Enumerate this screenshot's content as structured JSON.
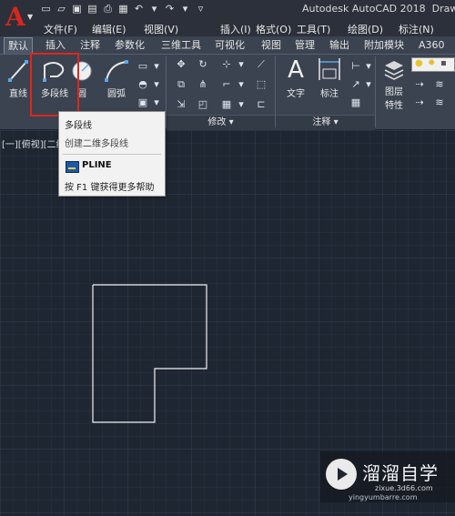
{
  "window": {
    "title": "Autodesk AutoCAD 2018",
    "title_suffix": "Draw",
    "colors": {
      "background": "#1e2632",
      "highlight": "#e0251b",
      "brand": "#d7261e"
    }
  },
  "app_button": {
    "label": "A",
    "icon": "app-menu-caret-icon"
  },
  "menu": [
    "文件(F)",
    "编辑(E)",
    "视图(V)",
    "插入(I)",
    "格式(O)",
    "工具(T)",
    "绘图(D)",
    "标注(N)"
  ],
  "tabs": [
    "默认",
    "插入",
    "注释",
    "参数化",
    "三维工具",
    "可视化",
    "视图",
    "管理",
    "输出",
    "附加模块",
    "A360"
  ],
  "active_tab": "默认",
  "ribbon": {
    "draw_tools": [
      {
        "label": "直线",
        "icon": "line-icon"
      },
      {
        "label": "多段线",
        "icon": "polyline-icon"
      },
      {
        "label": "圆",
        "icon": "circle-icon"
      },
      {
        "label": "圆弧",
        "icon": "arc-icon"
      }
    ],
    "modify_label": "修改",
    "annotation_tools": [
      {
        "label": "文字",
        "icon": "text-icon"
      },
      {
        "label": "标注",
        "icon": "dimension-icon"
      }
    ],
    "annotation_label": "注释",
    "layer_tools": {
      "line1": "图层",
      "line2": "特性"
    }
  },
  "viewport": {
    "label": "[一][俯视][二维"
  },
  "tooltip": {
    "title": "多段线",
    "description": "创建二维多段线",
    "command": "PLINE",
    "help": "按 F1 键获得更多帮助"
  },
  "watermark": {
    "name": "溜溜自学",
    "url": "zixue.3d66.com",
    "bottom": "yingyumbarre.com"
  }
}
